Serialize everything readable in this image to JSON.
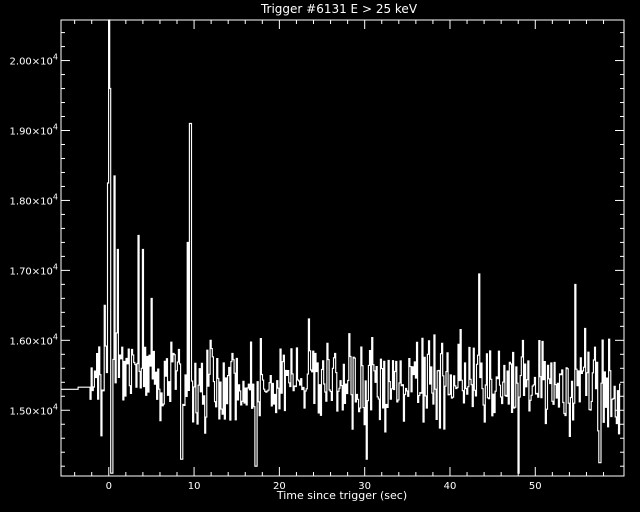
{
  "chart_data": {
    "type": "line",
    "title": "Trigger #6131 E > 25 keV",
    "xlabel": "Time since trigger (sec)",
    "ylabel": "",
    "xlim": [
      -5.6,
      60.4
    ],
    "ylim": [
      14060,
      20580
    ],
    "x_ticks": [
      0,
      10,
      20,
      30,
      40,
      50
    ],
    "x_tick_labels": [
      "0",
      "10",
      "20",
      "30",
      "40",
      "50"
    ],
    "y_ticks": [
      15000,
      16000,
      17000,
      18000,
      19000,
      20000
    ],
    "y_tick_labels": [
      {
        "mant": "1.50",
        "base": "×10",
        "exp": "4"
      },
      {
        "mant": "1.60",
        "base": "×10",
        "exp": "4"
      },
      {
        "mant": "1.70",
        "base": "×10",
        "exp": "4"
      },
      {
        "mant": "1.80",
        "base": "×10",
        "exp": "4"
      },
      {
        "mant": "1.90",
        "base": "×10",
        "exp": "4"
      },
      {
        "mant": "2.00",
        "base": "×10",
        "exp": "4"
      }
    ],
    "grid": false,
    "series": [
      {
        "color": "#ffffff",
        "step": 0.128,
        "baseline": 15400,
        "noise_amplitude": 560,
        "segments": [
          {
            "x0": -5.6,
            "x1": -3.6,
            "value": 15300
          },
          {
            "x0": -3.6,
            "x1": -2.2,
            "value": 15330
          }
        ],
        "peaks": [
          {
            "x": -1.7,
            "y": 15560
          },
          {
            "x": -0.5,
            "y": 16500
          },
          {
            "x": -0.2,
            "y": 18250
          },
          {
            "x": 0.0,
            "y": 20580
          },
          {
            "x": 0.15,
            "y": 19600
          },
          {
            "x": 0.3,
            "y": 18600
          },
          {
            "x": 0.6,
            "y": 18350
          },
          {
            "x": 1.0,
            "y": 17300
          },
          {
            "x": 3.4,
            "y": 17500
          },
          {
            "x": 3.9,
            "y": 17300
          },
          {
            "x": 5.0,
            "y": 16600
          },
          {
            "x": 9.2,
            "y": 17400
          },
          {
            "x": 9.5,
            "y": 19100
          },
          {
            "x": 43.4,
            "y": 16950
          },
          {
            "x": 54.6,
            "y": 16800
          }
        ],
        "dips": [
          {
            "x": 0.3,
            "y": 14100
          },
          {
            "x": 8.5,
            "y": 14300
          },
          {
            "x": 17.2,
            "y": 14200
          },
          {
            "x": 30.2,
            "y": 14300
          },
          {
            "x": 48.0,
            "y": 14100
          },
          {
            "x": 57.5,
            "y": 14250
          }
        ]
      }
    ]
  }
}
